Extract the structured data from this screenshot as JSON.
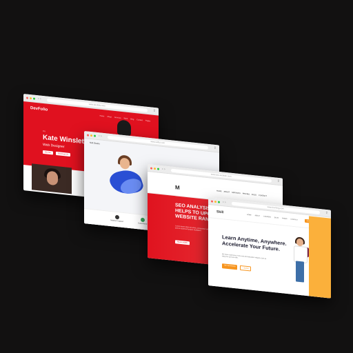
{
  "windows": [
    {
      "url": "www.devfolio.com",
      "logo": "DevFolio",
      "menu": [
        "Home",
        "About",
        "Services",
        "Work",
        "Blog",
        "Contact",
        "Pages"
      ],
      "greeting": "I'm",
      "name": "Kate Winslet",
      "role": "Web Designer",
      "buttons": [
        "Hire Me",
        "Download CV"
      ]
    },
    {
      "url": "www.softui.com",
      "mini_title": "Soft Studio",
      "features": [
        "Satisfied Support",
        "Guaranteed"
      ]
    },
    {
      "url": "www.seo-website.com",
      "logo": "M",
      "nav": [
        "HOME",
        "ABOUT",
        "SERVICES",
        "PRICING",
        "BLOG",
        "CONTACT"
      ],
      "headline": "SEO ANALYSIS HELPS TO UPGRADE WEBSITE RANKING",
      "body": "Lorem ipsum dolor sit amet, consectetur adipiscing elit, sed do eiusmod tempor incididunt.",
      "button": "READ MORE"
    },
    {
      "url": "www.learning.com",
      "logo": "Skill",
      "nav": [
        "HOME",
        "ABOUT",
        "COURSES",
        "BLOG",
        "PAGES",
        "CONTACT"
      ],
      "cta": "JOIN NOW",
      "headline": "Learn Anytime, Anywhere. Accelerate Your Future.",
      "body": "We have experience in the web and education industry. Join us today for our best offer.",
      "buttons": [
        "GET STARTED",
        "LEARN"
      ]
    }
  ]
}
